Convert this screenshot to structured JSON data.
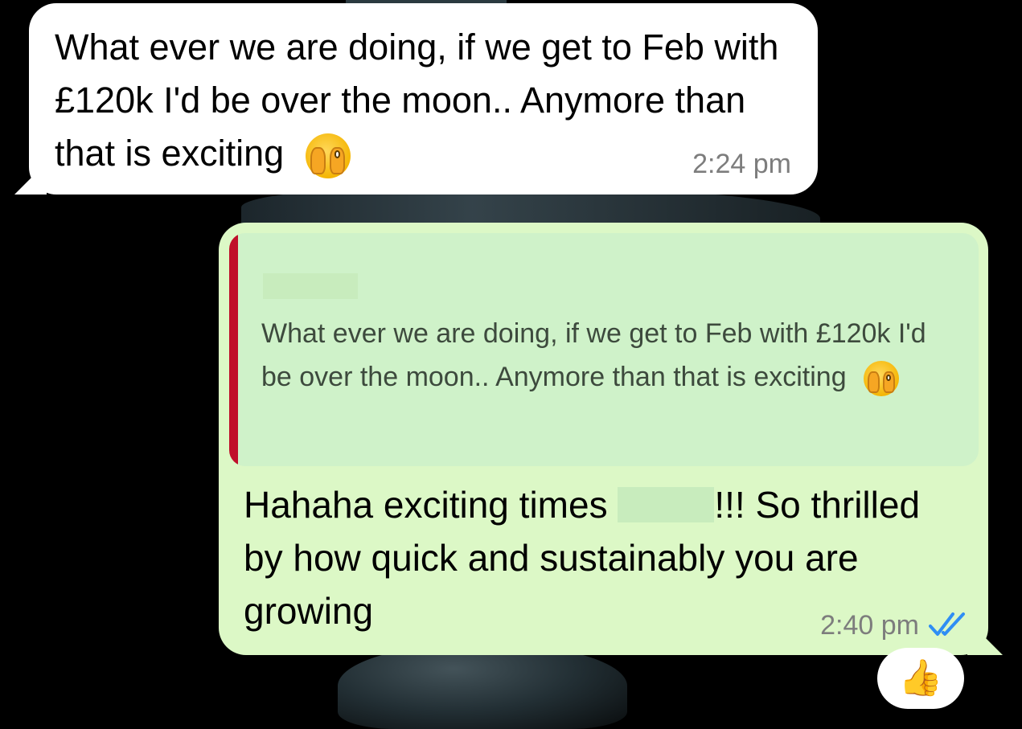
{
  "incoming_message": {
    "text": "What ever we are doing, if we get to Feb with £120k I'd be over the moon.. Anymore than that is exciting",
    "emoji": "face-with-open-eyes-and-hand-over-mouth",
    "time": "2:24 pm"
  },
  "outgoing_message": {
    "quoted": {
      "author": "",
      "text": "What ever we are doing, if we get to Feb with £120k I'd be over the moon.. Anymore than that is exciting",
      "accent_color": "#c0102a"
    },
    "reply_part1": "Hahaha exciting times",
    "reply_part2": "!!! So thrilled by how quick and sustainably you are growing",
    "time": "2:40 pm",
    "status": "read",
    "status_color": "#2f8ef4"
  },
  "reaction": {
    "emoji": "👍"
  },
  "colors": {
    "incoming_bubble": "#ffffff",
    "outgoing_bubble": "#dcf8c6",
    "quote_background": "#cff2c9"
  }
}
